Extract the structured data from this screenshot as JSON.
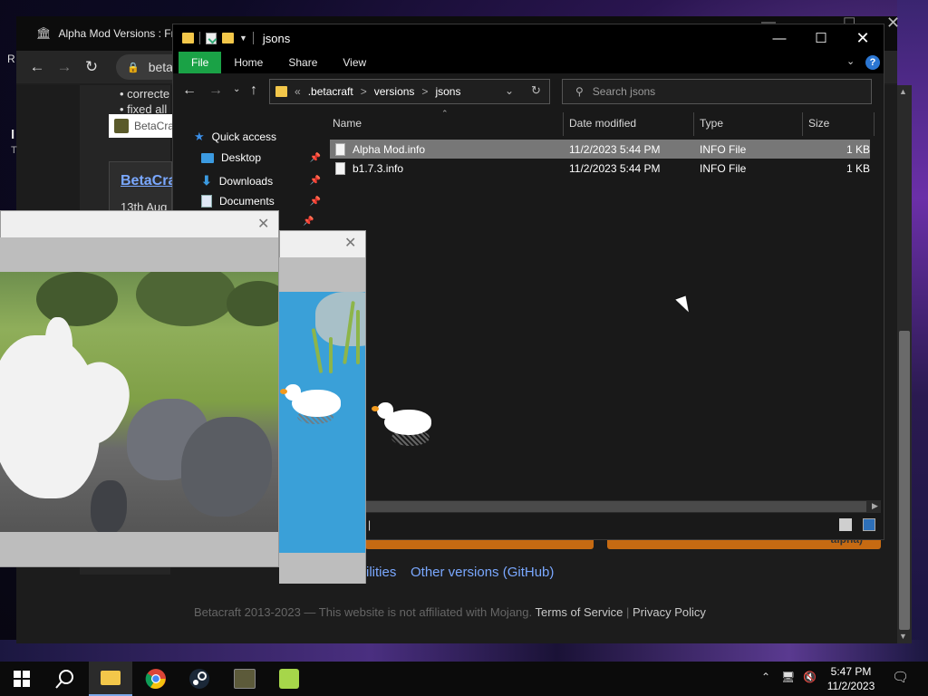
{
  "browser": {
    "tab_title": "Alpha Mod Versions : Fr",
    "url_text": "betac",
    "bullets": [
      "• correcte",
      "• fixed all"
    ],
    "betacraft_tab": "BetaCra",
    "card_link": "BetaCra",
    "card_date": "13th Aug",
    "left_r": "R",
    "left_i": "I",
    "left_t": "T",
    "orange_btn_text": "alpha)",
    "link_utilities": "ilities",
    "link_other_versions": "Other versions (GitHub)",
    "footer_text": "Betacraft 2013-2023 — This website is not affiliated with Mojang.",
    "footer_tos": "Terms of Service",
    "footer_sep": "|",
    "footer_privacy": "Privacy Policy"
  },
  "explorer": {
    "title": "jsons",
    "ribbon_tabs": [
      "File",
      "Home",
      "Share",
      "View"
    ],
    "breadcrumb": [
      "«",
      ".betacraft",
      ">",
      "versions",
      ">",
      "jsons"
    ],
    "search_placeholder": "Search jsons",
    "nav": [
      {
        "label": "Quick access",
        "icon": "star-icon",
        "pinned": false
      },
      {
        "label": "Desktop",
        "icon": "desktop-icon",
        "pinned": true
      },
      {
        "label": "Downloads",
        "icon": "download-icon",
        "pinned": true
      },
      {
        "label": "Documents",
        "icon": "documents-icon",
        "pinned": true
      }
    ],
    "columns": [
      "Name",
      "Date modified",
      "Type",
      "Size"
    ],
    "files": [
      {
        "name": "Alpha Mod.info",
        "date": "11/2/2023 5:44 PM",
        "type": "INFO File",
        "size": "1 KB",
        "selected": true
      },
      {
        "name": "b1.7.3.info",
        "date": "11/2/2023 5:44 PM",
        "type": "INFO File",
        "size": "1 KB",
        "selected": false
      }
    ],
    "status_text": "|"
  },
  "taskbar": {
    "time": "5:47 PM",
    "date": "11/2/2023",
    "apps": [
      "windows-start-icon",
      "search-icon",
      "file-explorer-icon",
      "chrome-icon",
      "steam-icon",
      "betacraft-icon",
      "goose-app-icon"
    ]
  },
  "colors": {
    "accent_green": "#1aa246",
    "link_blue": "#7aa8ff",
    "orange": "#c66a12"
  }
}
